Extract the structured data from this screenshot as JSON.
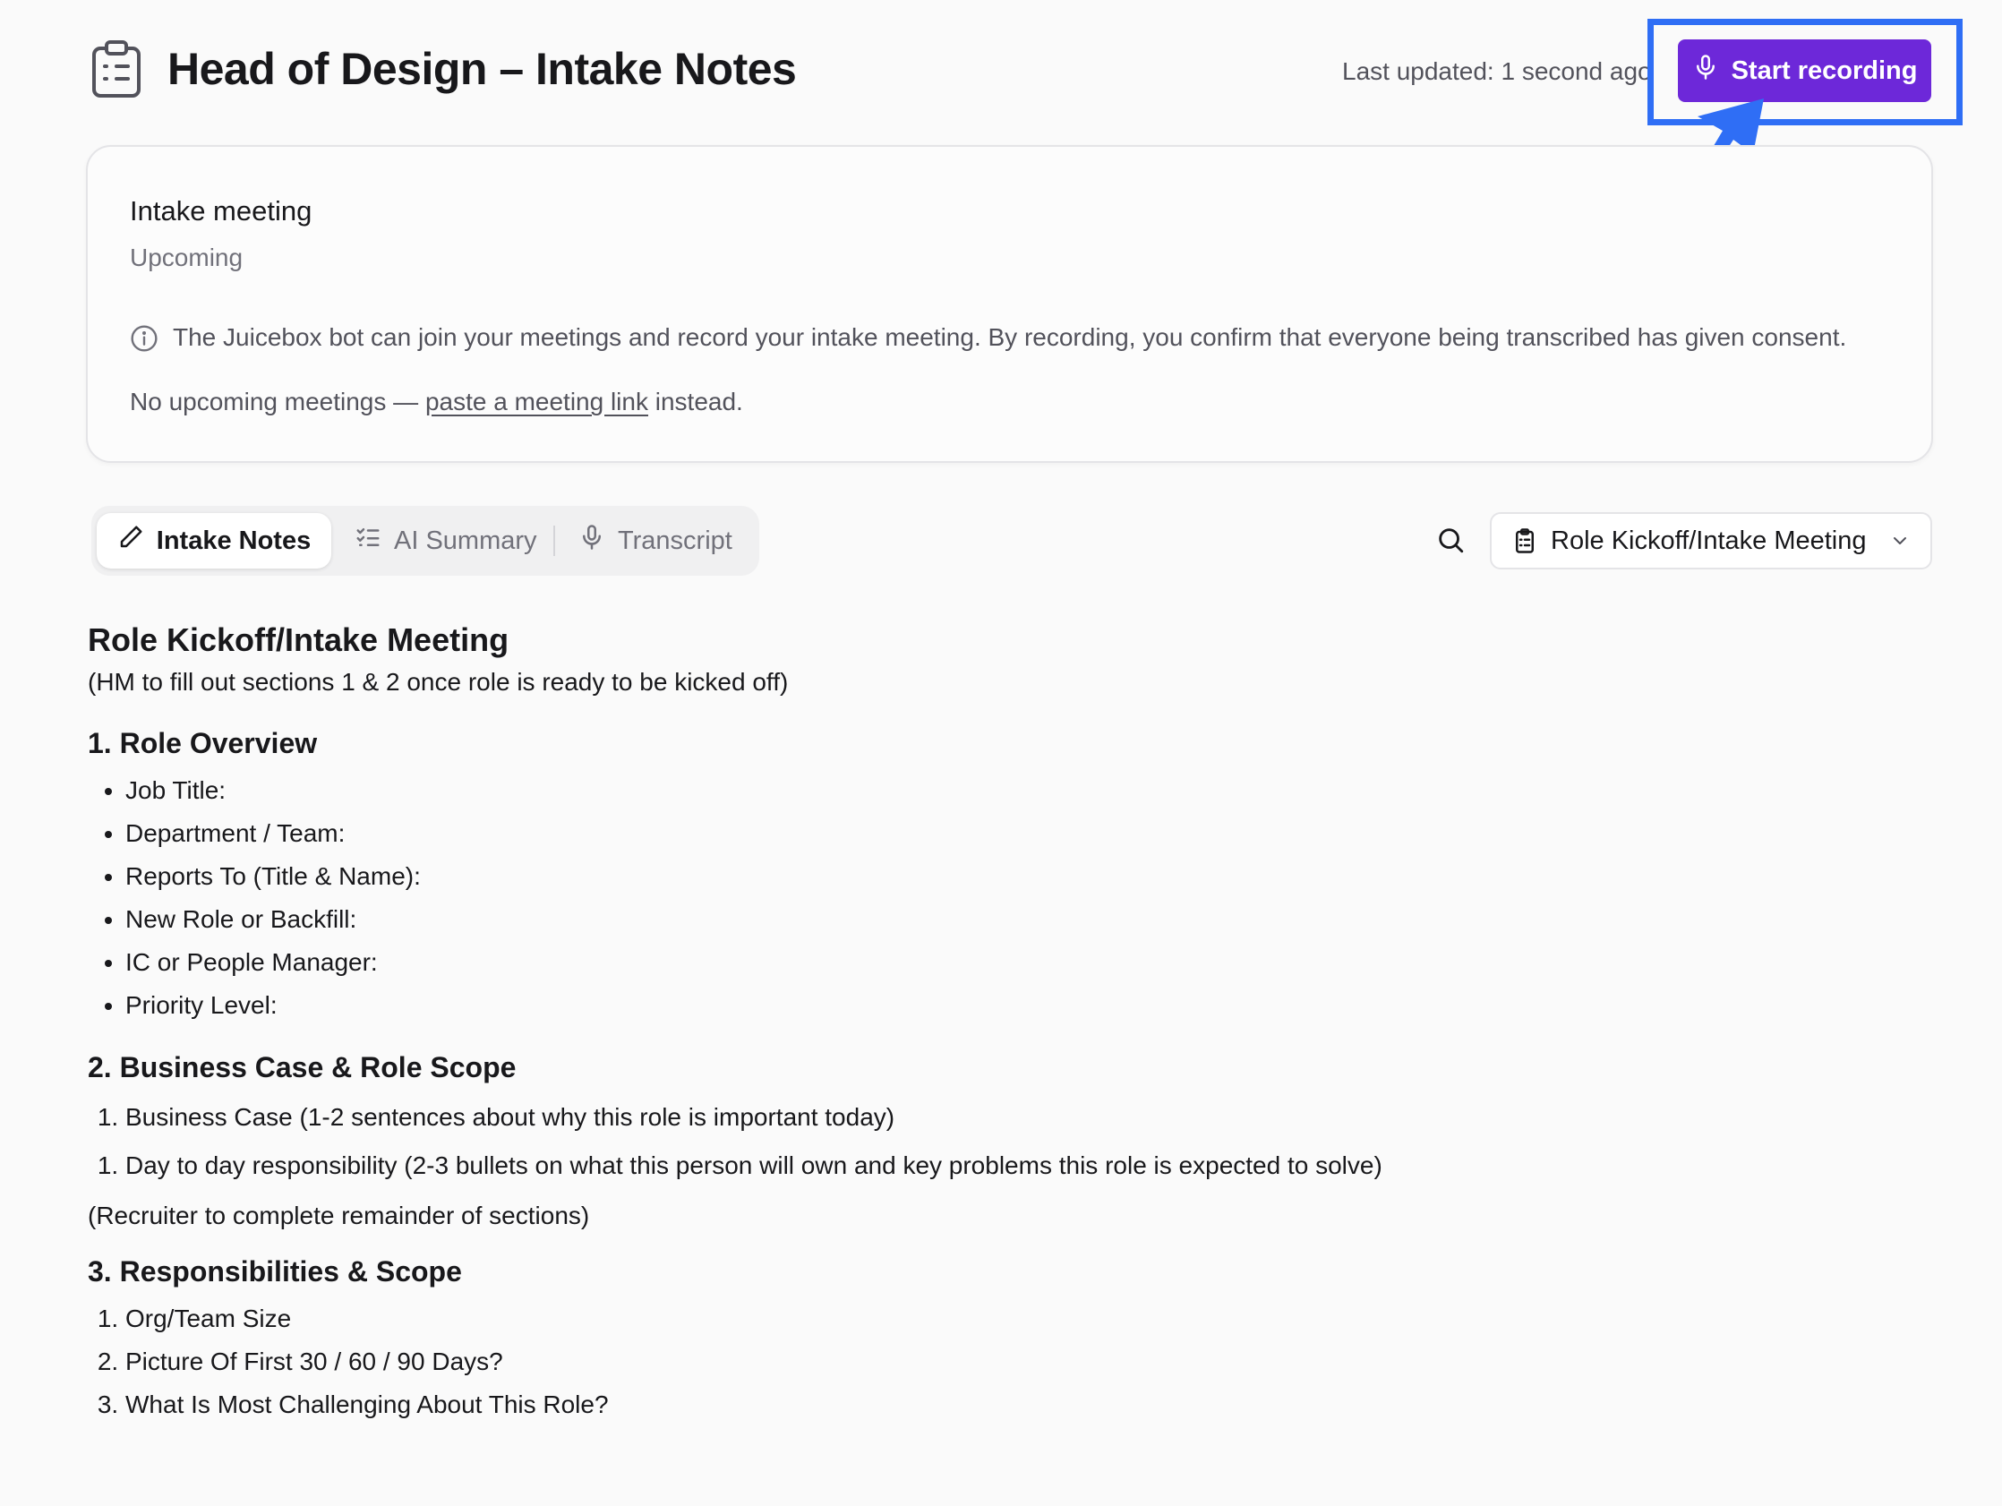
{
  "header": {
    "title": "Head of Design – Intake Notes",
    "last_updated": "Last updated: 1 second ago",
    "record_button": "Start recording",
    "accent_color": "#6d28d9",
    "annotation_color": "#2f6ef5"
  },
  "meeting_card": {
    "title": "Intake meeting",
    "status": "Upcoming",
    "consent_notice": "The Juicebox bot can join your meetings and record your intake meeting. By recording, you confirm that everyone being transcribed has given consent.",
    "no_meetings_prefix": "No upcoming meetings — ",
    "no_meetings_link": "paste a meeting link",
    "no_meetings_suffix": " instead."
  },
  "tabs": [
    {
      "label": "Intake Notes",
      "icon": "pencil-icon",
      "active": true
    },
    {
      "label": "AI Summary",
      "icon": "checklist-icon",
      "active": false
    },
    {
      "label": "Transcript",
      "icon": "microphone-icon",
      "active": false
    }
  ],
  "template_select": {
    "value": "Role Kickoff/Intake Meeting",
    "icon": "clipboard-icon"
  },
  "document": {
    "title": "Role Kickoff/Intake Meeting",
    "intro": "(HM to fill out sections 1 & 2 once role is ready to be kicked off)",
    "section1": {
      "heading": "1. Role Overview",
      "items": [
        "Job Title:",
        "Department / Team:",
        "Reports To (Title & Name):",
        "New Role or Backfill:",
        "IC or People Manager:",
        "Priority Level:"
      ]
    },
    "section2": {
      "heading": "2. Business Case & Role Scope",
      "items": [
        "Business Case (1-2 sentences about why this role is important today)",
        "Day to day responsibility (2-3 bullets on what this person will own and key problems this role is expected to solve)"
      ]
    },
    "recruiter_note": "(Recruiter to complete remainder of sections)",
    "section3": {
      "heading": "3. Responsibilities & Scope",
      "items": [
        "Org/Team Size",
        "Picture Of First 30 / 60 / 90 Days?",
        "What Is Most Challenging About This Role?"
      ]
    }
  }
}
